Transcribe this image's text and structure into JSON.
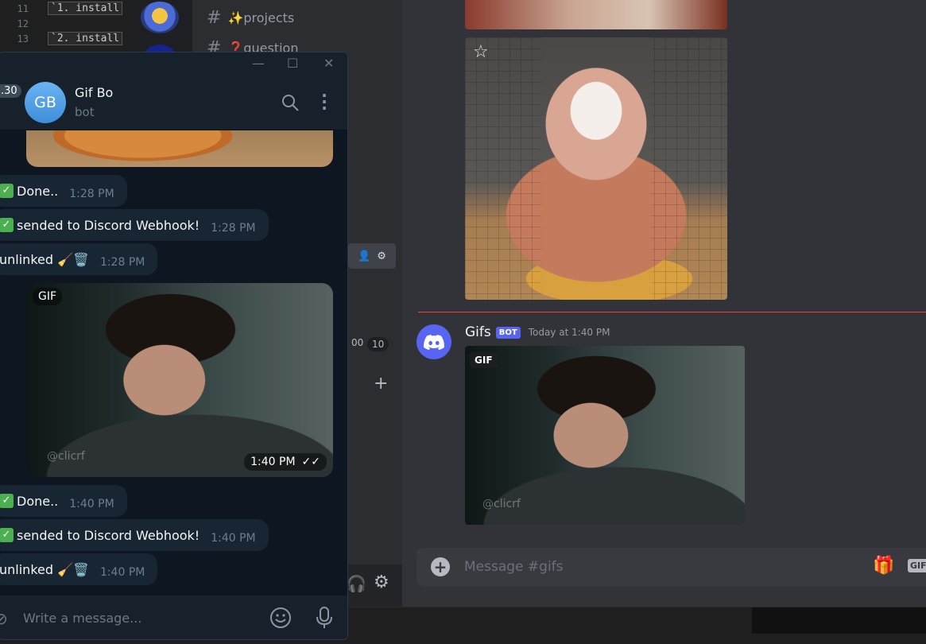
{
  "editor": {
    "lines": [
      {
        "num": "11",
        "code": "`1. install"
      },
      {
        "num": "12",
        "code": ""
      },
      {
        "num": "13",
        "code": "`2. install"
      }
    ]
  },
  "discord": {
    "channels": [
      {
        "name": "✨projects"
      },
      {
        "name": "❓question"
      }
    ],
    "time_chips": [
      "00",
      "10"
    ],
    "message": {
      "author": "Gifs",
      "badge": "BOT",
      "timestamp": "Today at 1:40 PM",
      "gif_label": "GIF",
      "watermark": "@clicrf"
    },
    "composer": {
      "placeholder": "Message #gifs",
      "gif_button": "GIF"
    },
    "colors": {
      "blurple": "#5865f2",
      "bg": "#313338",
      "divider": "#f23f43"
    }
  },
  "telegram": {
    "unread_badge": ".30",
    "chat": {
      "avatar_initials": "GB",
      "name": "Gif Bo",
      "status": "bot"
    },
    "messages": [
      {
        "text": "Done..",
        "prefix_icon": "check-emoji",
        "time": "1:28 PM"
      },
      {
        "text": "sended to Discord Webhook!",
        "prefix_icon": "check-emoji",
        "time": "1:28 PM"
      },
      {
        "text": "unlinked 🧹🗑️",
        "prefix_icon": "",
        "time": "1:28 PM"
      },
      {
        "text": "Done..",
        "prefix_icon": "check-emoji",
        "time": "1:40 PM"
      },
      {
        "text": "sended to Discord Webhook!",
        "prefix_icon": "check-emoji",
        "time": "1:40 PM"
      },
      {
        "text": "unlinked 🧹🗑️",
        "prefix_icon": "",
        "time": "1:40 PM"
      }
    ],
    "gif": {
      "label": "GIF",
      "time": "1:40 PM",
      "watermark": "@clicrf"
    },
    "input": {
      "placeholder": "Write a message..."
    },
    "colors": {
      "accent": "#3e8ed8",
      "bg": "#0e1621",
      "bubble": "#182533"
    }
  }
}
